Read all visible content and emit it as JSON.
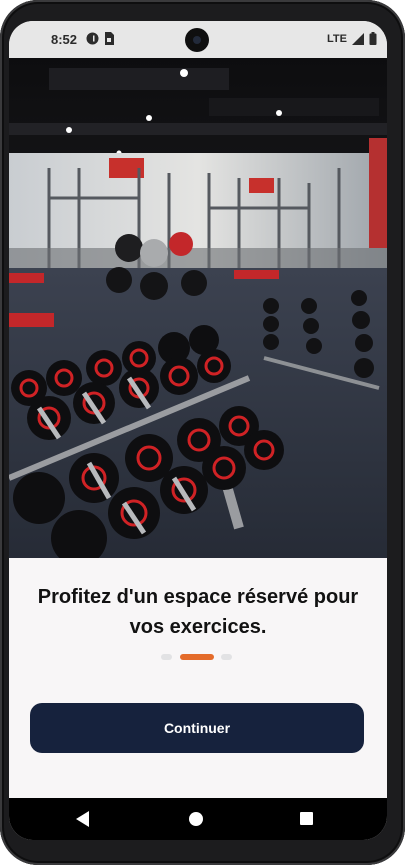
{
  "status_bar": {
    "time": "8:52",
    "network": "LTE",
    "icons": [
      "notification-app-icon",
      "sim-card-icon",
      "signal-icon",
      "battery-icon"
    ]
  },
  "hero_image": {
    "description_icon": "gym-dumbbells-photo"
  },
  "onboarding": {
    "title": "Profitez d'un espace réservé pour vos exercices.",
    "page_indicator": {
      "total": 3,
      "active": 2
    },
    "active_color": "#e46b2a",
    "continue_label": "Continuer"
  },
  "nav_bar": {
    "icons": [
      "back-icon",
      "home-icon",
      "recents-icon"
    ]
  },
  "colors": {
    "button_bg": "#16223d",
    "page_bg": "#f8f6f7"
  }
}
